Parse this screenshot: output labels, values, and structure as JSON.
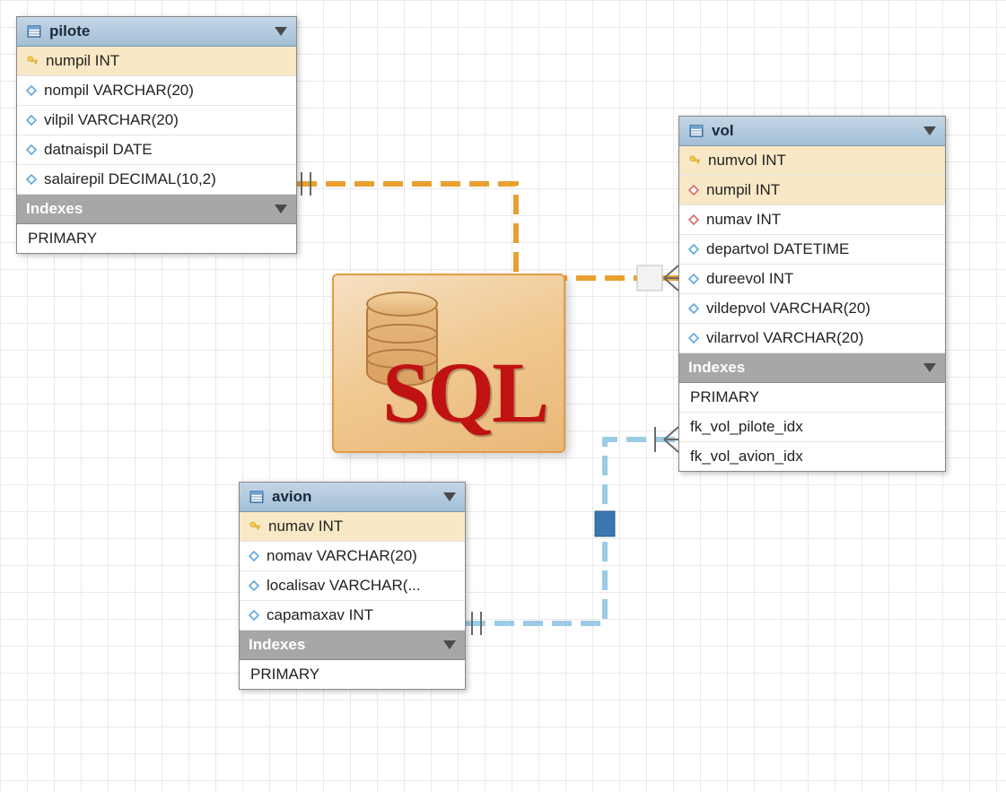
{
  "logo_text": "SQL",
  "tables": {
    "pilote": {
      "name": "pilote",
      "indexes_label": "Indexes",
      "columns": [
        {
          "icon": "key",
          "label": "numpil INT",
          "pk": true
        },
        {
          "icon": "diamond-blue",
          "label": "nompil VARCHAR(20)"
        },
        {
          "icon": "diamond-blue",
          "label": "vilpil VARCHAR(20)"
        },
        {
          "icon": "diamond-blue",
          "label": "datnaispil DATE"
        },
        {
          "icon": "diamond-blue",
          "label": "salairepil DECIMAL(10,2)"
        }
      ],
      "indexes": [
        "PRIMARY"
      ]
    },
    "avion": {
      "name": "avion",
      "indexes_label": "Indexes",
      "columns": [
        {
          "icon": "key",
          "label": "numav INT",
          "pk": true
        },
        {
          "icon": "diamond-blue",
          "label": "nomav VARCHAR(20)"
        },
        {
          "icon": "diamond-blue",
          "label": "localisav VARCHAR(..."
        },
        {
          "icon": "diamond-blue",
          "label": "capamaxav INT"
        }
      ],
      "indexes": [
        "PRIMARY"
      ]
    },
    "vol": {
      "name": "vol",
      "indexes_label": "Indexes",
      "columns": [
        {
          "icon": "key",
          "label": "numvol INT",
          "pk": true
        },
        {
          "icon": "diamond-red",
          "label": "numpil INT",
          "fk_hl": true
        },
        {
          "icon": "diamond-red",
          "label": "numav INT"
        },
        {
          "icon": "diamond-blue",
          "label": "departvol DATETIME"
        },
        {
          "icon": "diamond-blue",
          "label": "dureevol INT"
        },
        {
          "icon": "diamond-blue",
          "label": "vildepvol VARCHAR(20)"
        },
        {
          "icon": "diamond-blue",
          "label": "vilarrvol VARCHAR(20)"
        }
      ],
      "indexes": [
        "PRIMARY",
        "fk_vol_pilote_idx",
        "fk_vol_avion_idx"
      ]
    }
  },
  "relations": [
    {
      "from": "pilote",
      "to": "vol",
      "color": "#e8a030",
      "via": "numpil"
    },
    {
      "from": "avion",
      "to": "vol",
      "color": "#8db6d6",
      "via": "numav"
    }
  ]
}
